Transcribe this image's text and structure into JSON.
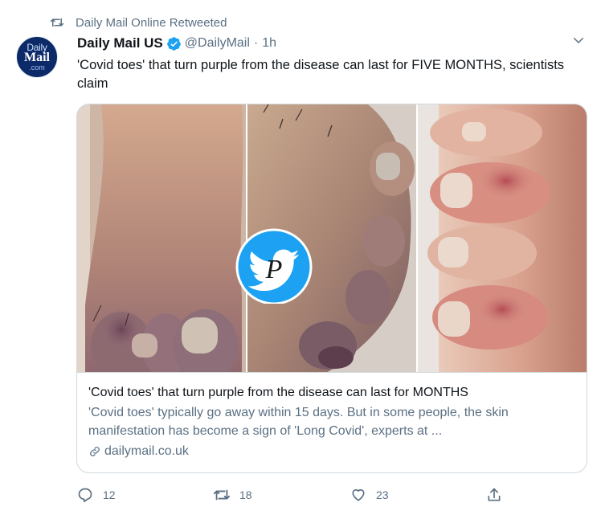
{
  "retweet": {
    "icon": "retweet-icon",
    "text": "Daily Mail Online Retweeted"
  },
  "author": {
    "avatar": {
      "line1": "Daily",
      "line2": "Mail",
      "line3": ".com",
      "bg": "#0c2a68"
    },
    "name": "Daily Mail US",
    "verified_icon": "verified-badge-icon",
    "handle": "@DailyMail",
    "separator": "·",
    "time": "1h"
  },
  "menu_icon": "chevron-down-icon",
  "tweet": {
    "text": "'Covid toes' that turn purple from the disease can last for FIVE MONTHS, scientists claim"
  },
  "card": {
    "title": "'Covid toes' that turn purple from the disease can last for MONTHS",
    "description": "'Covid toes' typically go away within 15 days. But in some people, the skin manifestation has become a sign of 'Long Covid', experts at ...",
    "link_icon": "link-icon",
    "domain": "dailymail.co.uk",
    "overlay_icon": "twitter-bird-icon",
    "overlay_letter": "P"
  },
  "actions": {
    "reply": {
      "icon": "reply-icon",
      "count": "12"
    },
    "retweet": {
      "icon": "retweet-icon",
      "count": "18"
    },
    "like": {
      "icon": "heart-icon",
      "count": "23"
    },
    "share": {
      "icon": "share-icon"
    }
  },
  "colors": {
    "text_primary": "#0f1419",
    "text_secondary": "#5b7083",
    "twitter_blue": "#1da1f2",
    "border": "#cfd9de"
  }
}
